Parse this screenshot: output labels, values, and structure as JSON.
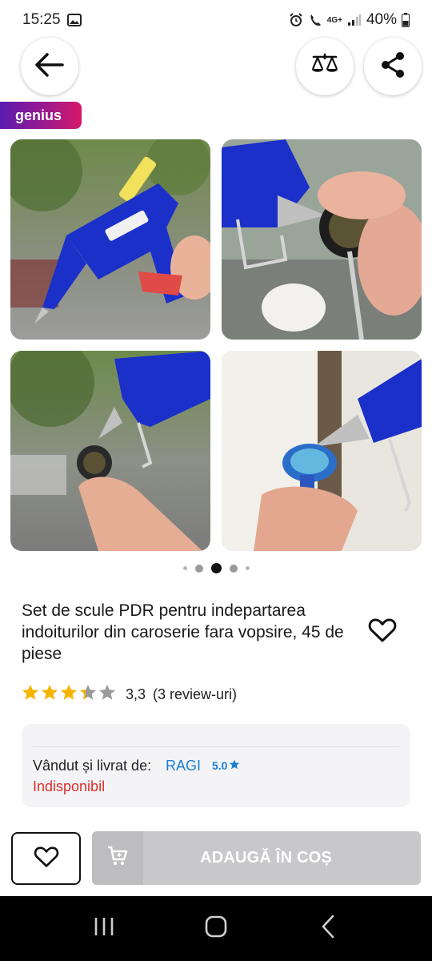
{
  "status_bar": {
    "time": "15:25",
    "network": "4G+",
    "battery": "40%"
  },
  "header": {
    "back_icon": "arrow-left-icon",
    "compare_icon": "scale-icon",
    "share_icon": "share-icon",
    "badge": "genius"
  },
  "gallery": {
    "images": [
      "glue-gun-image-1",
      "glue-gun-image-2",
      "glue-gun-image-3",
      "glue-gun-image-4"
    ],
    "dots": 5,
    "active_dot": 2
  },
  "product": {
    "title": "Set de scule PDR pentru indepartarea indoiturilor din caroserie fara vopsire, 45 de piese",
    "rating": 3.3,
    "rating_text": "3,3",
    "review_text": "(3 review-uri)",
    "stars_total": 5
  },
  "seller": {
    "sold_by_label": "Vândut și livrat de:",
    "name": "RAGI",
    "score": "5.0",
    "availability": "Indisponibil"
  },
  "actions": {
    "add_to_cart_label": "ADAUGĂ ÎN COȘ"
  },
  "colors": {
    "accent_blue": "#1a7fd6",
    "unavailable_red": "#d9302b",
    "star_yellow": "#f5b400",
    "button_disabled": "#c8c8ca"
  }
}
